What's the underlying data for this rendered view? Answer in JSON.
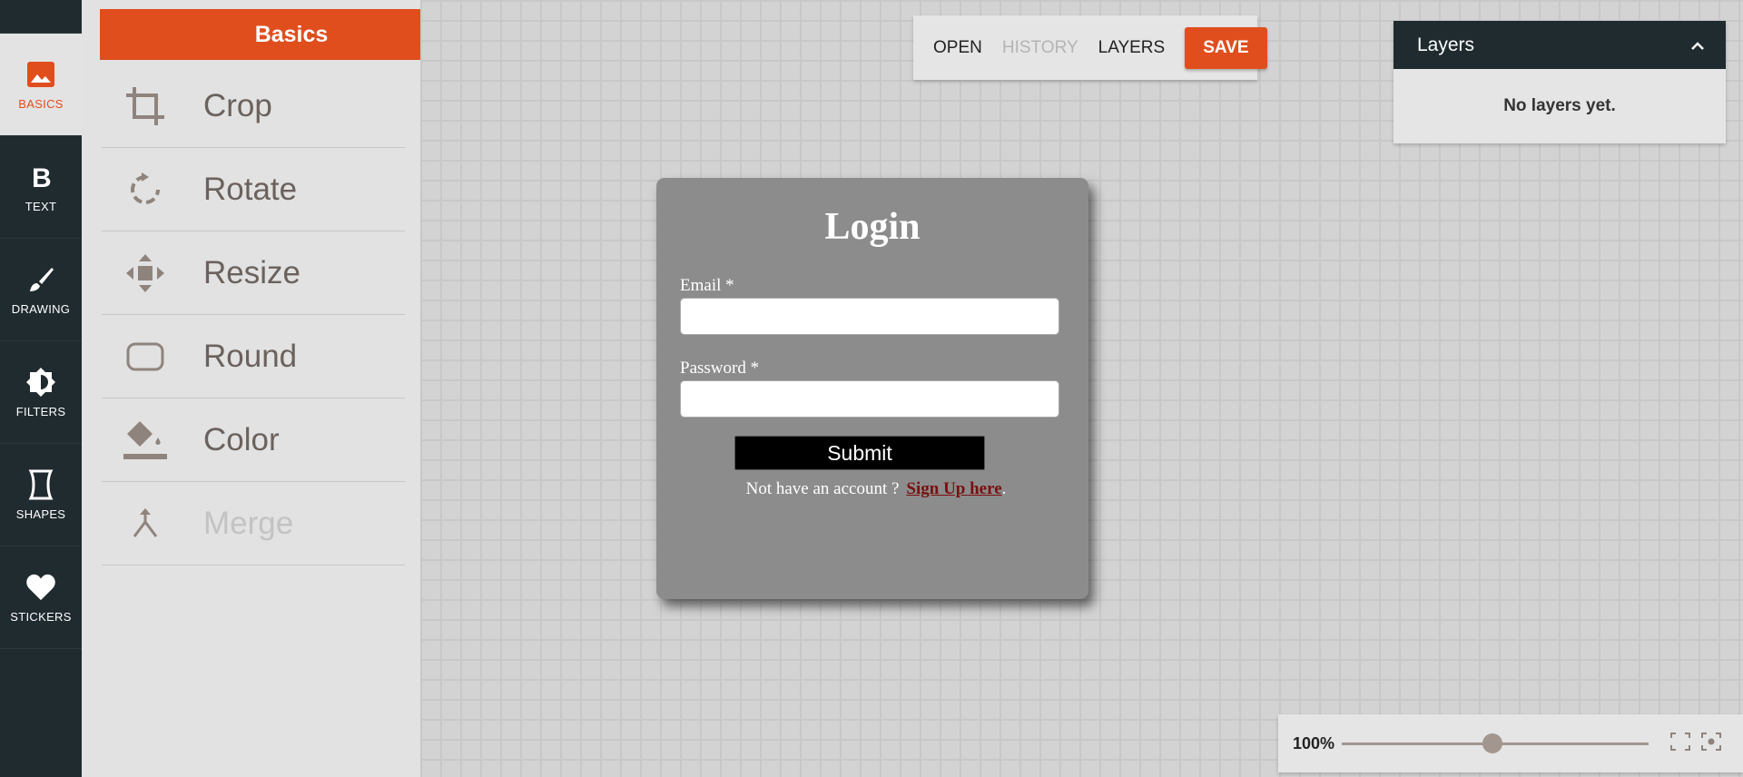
{
  "rail": {
    "items": [
      {
        "label": "BASICS",
        "icon": "image-icon",
        "active": true
      },
      {
        "label": "TEXT",
        "icon": "bold-text-icon"
      },
      {
        "label": "DRAWING",
        "icon": "brush-icon"
      },
      {
        "label": "FILTERS",
        "icon": "contrast-icon"
      },
      {
        "label": "SHAPES",
        "icon": "shape-icon"
      },
      {
        "label": "STICKERS",
        "icon": "heart-icon"
      }
    ]
  },
  "panel": {
    "title": "Basics",
    "tools": [
      {
        "label": "Crop",
        "icon": "crop-icon"
      },
      {
        "label": "Rotate",
        "icon": "rotate-icon"
      },
      {
        "label": "Resize",
        "icon": "move-arrows-icon"
      },
      {
        "label": "Round",
        "icon": "rounded-rect-icon"
      },
      {
        "label": "Color",
        "icon": "paint-bucket-icon"
      },
      {
        "label": "Merge",
        "icon": "merge-icon",
        "disabled": true
      }
    ]
  },
  "toolbar": {
    "open": "OPEN",
    "history": "HISTORY",
    "layers": "LAYERS",
    "save": "SAVE"
  },
  "layers_panel": {
    "title": "Layers",
    "empty_text": "No layers yet."
  },
  "login": {
    "title": "Login",
    "email_label": "Email *",
    "password_label": "Password *",
    "submit": "Submit",
    "footer_text": "Not have an account ?",
    "signup_link": "Sign Up here",
    "footer_end": "."
  },
  "zoom": {
    "level": "100%",
    "slider_fraction": 0.49
  },
  "colors": {
    "accent": "#e04e1e",
    "rail_bg": "#202b30",
    "panel_bg": "#e2e2e2"
  }
}
